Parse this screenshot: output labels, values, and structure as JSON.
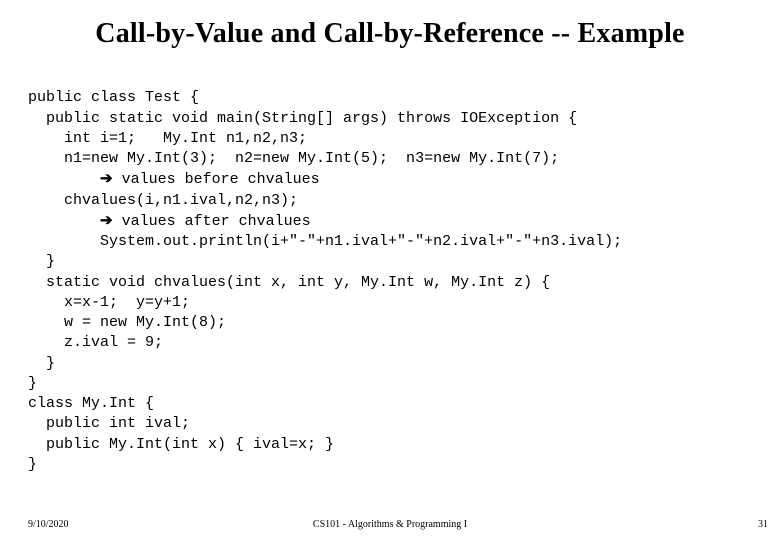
{
  "title": "Call-by-Value and Call-by-Reference -- Example",
  "code": {
    "l1": "public class Test {",
    "l2": "  public static void main(String[] args) throws IOException {",
    "l3": "    int i=1;   My.Int n1,n2,n3;",
    "l4": "    n1=new My.Int(3);  n2=new My.Int(5);  n3=new My.Int(7);",
    "l5a": "        ",
    "l5b": " values before chvalues",
    "l6": "    chvalues(i,n1.ival,n2,n3);",
    "l7a": "        ",
    "l7b": " values after chvalues",
    "l8": "        System.out.println(i+\"-\"+n1.ival+\"-\"+n2.ival+\"-\"+n3.ival);",
    "l9": "  }",
    "l10": "  static void chvalues(int x, int y, My.Int w, My.Int z) {",
    "l11": "    x=x-1;  y=y+1;",
    "l12": "    w = new My.Int(8);",
    "l13": "    z.ival = 9;",
    "l14": "  }",
    "l15": "}",
    "l16": "class My.Int {",
    "l17": "  public int ival;",
    "l18": "  public My.Int(int x) { ival=x; }",
    "l19": "}"
  },
  "arrow": "➔",
  "footer": {
    "date": "9/10/2020",
    "course": "CS101 - Algorithms & Programming I",
    "page": "31"
  }
}
